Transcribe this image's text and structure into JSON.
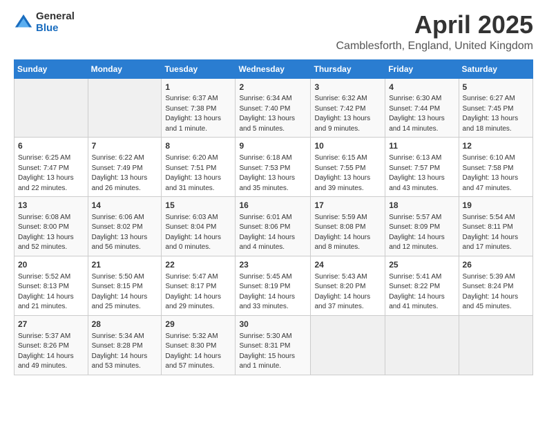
{
  "logo": {
    "general": "General",
    "blue": "Blue"
  },
  "header": {
    "title": "April 2025",
    "location": "Camblesforth, England, United Kingdom"
  },
  "weekdays": [
    "Sunday",
    "Monday",
    "Tuesday",
    "Wednesday",
    "Thursday",
    "Friday",
    "Saturday"
  ],
  "weeks": [
    [
      {
        "day": "",
        "info": ""
      },
      {
        "day": "",
        "info": ""
      },
      {
        "day": "1",
        "info": "Sunrise: 6:37 AM\nSunset: 7:38 PM\nDaylight: 13 hours and 1 minute."
      },
      {
        "day": "2",
        "info": "Sunrise: 6:34 AM\nSunset: 7:40 PM\nDaylight: 13 hours and 5 minutes."
      },
      {
        "day": "3",
        "info": "Sunrise: 6:32 AM\nSunset: 7:42 PM\nDaylight: 13 hours and 9 minutes."
      },
      {
        "day": "4",
        "info": "Sunrise: 6:30 AM\nSunset: 7:44 PM\nDaylight: 13 hours and 14 minutes."
      },
      {
        "day": "5",
        "info": "Sunrise: 6:27 AM\nSunset: 7:45 PM\nDaylight: 13 hours and 18 minutes."
      }
    ],
    [
      {
        "day": "6",
        "info": "Sunrise: 6:25 AM\nSunset: 7:47 PM\nDaylight: 13 hours and 22 minutes."
      },
      {
        "day": "7",
        "info": "Sunrise: 6:22 AM\nSunset: 7:49 PM\nDaylight: 13 hours and 26 minutes."
      },
      {
        "day": "8",
        "info": "Sunrise: 6:20 AM\nSunset: 7:51 PM\nDaylight: 13 hours and 31 minutes."
      },
      {
        "day": "9",
        "info": "Sunrise: 6:18 AM\nSunset: 7:53 PM\nDaylight: 13 hours and 35 minutes."
      },
      {
        "day": "10",
        "info": "Sunrise: 6:15 AM\nSunset: 7:55 PM\nDaylight: 13 hours and 39 minutes."
      },
      {
        "day": "11",
        "info": "Sunrise: 6:13 AM\nSunset: 7:57 PM\nDaylight: 13 hours and 43 minutes."
      },
      {
        "day": "12",
        "info": "Sunrise: 6:10 AM\nSunset: 7:58 PM\nDaylight: 13 hours and 47 minutes."
      }
    ],
    [
      {
        "day": "13",
        "info": "Sunrise: 6:08 AM\nSunset: 8:00 PM\nDaylight: 13 hours and 52 minutes."
      },
      {
        "day": "14",
        "info": "Sunrise: 6:06 AM\nSunset: 8:02 PM\nDaylight: 13 hours and 56 minutes."
      },
      {
        "day": "15",
        "info": "Sunrise: 6:03 AM\nSunset: 8:04 PM\nDaylight: 14 hours and 0 minutes."
      },
      {
        "day": "16",
        "info": "Sunrise: 6:01 AM\nSunset: 8:06 PM\nDaylight: 14 hours and 4 minutes."
      },
      {
        "day": "17",
        "info": "Sunrise: 5:59 AM\nSunset: 8:08 PM\nDaylight: 14 hours and 8 minutes."
      },
      {
        "day": "18",
        "info": "Sunrise: 5:57 AM\nSunset: 8:09 PM\nDaylight: 14 hours and 12 minutes."
      },
      {
        "day": "19",
        "info": "Sunrise: 5:54 AM\nSunset: 8:11 PM\nDaylight: 14 hours and 17 minutes."
      }
    ],
    [
      {
        "day": "20",
        "info": "Sunrise: 5:52 AM\nSunset: 8:13 PM\nDaylight: 14 hours and 21 minutes."
      },
      {
        "day": "21",
        "info": "Sunrise: 5:50 AM\nSunset: 8:15 PM\nDaylight: 14 hours and 25 minutes."
      },
      {
        "day": "22",
        "info": "Sunrise: 5:47 AM\nSunset: 8:17 PM\nDaylight: 14 hours and 29 minutes."
      },
      {
        "day": "23",
        "info": "Sunrise: 5:45 AM\nSunset: 8:19 PM\nDaylight: 14 hours and 33 minutes."
      },
      {
        "day": "24",
        "info": "Sunrise: 5:43 AM\nSunset: 8:20 PM\nDaylight: 14 hours and 37 minutes."
      },
      {
        "day": "25",
        "info": "Sunrise: 5:41 AM\nSunset: 8:22 PM\nDaylight: 14 hours and 41 minutes."
      },
      {
        "day": "26",
        "info": "Sunrise: 5:39 AM\nSunset: 8:24 PM\nDaylight: 14 hours and 45 minutes."
      }
    ],
    [
      {
        "day": "27",
        "info": "Sunrise: 5:37 AM\nSunset: 8:26 PM\nDaylight: 14 hours and 49 minutes."
      },
      {
        "day": "28",
        "info": "Sunrise: 5:34 AM\nSunset: 8:28 PM\nDaylight: 14 hours and 53 minutes."
      },
      {
        "day": "29",
        "info": "Sunrise: 5:32 AM\nSunset: 8:30 PM\nDaylight: 14 hours and 57 minutes."
      },
      {
        "day": "30",
        "info": "Sunrise: 5:30 AM\nSunset: 8:31 PM\nDaylight: 15 hours and 1 minute."
      },
      {
        "day": "",
        "info": ""
      },
      {
        "day": "",
        "info": ""
      },
      {
        "day": "",
        "info": ""
      }
    ]
  ]
}
